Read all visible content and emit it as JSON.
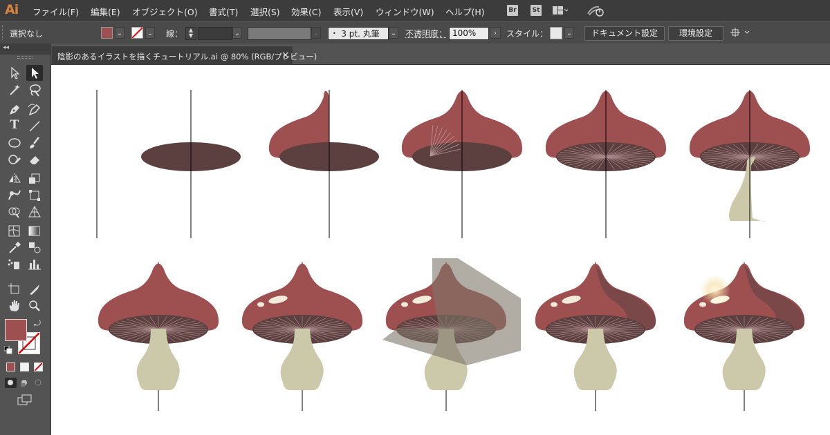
{
  "app": {
    "logo": "Ai"
  },
  "menu": [
    "ファイル(F)",
    "編集(E)",
    "オブジェクト(O)",
    "書式(T)",
    "選択(S)",
    "効果(C)",
    "表示(V)",
    "ウィンドウ(W)",
    "ヘルプ(H)"
  ],
  "app_buttons": {
    "bridge": "Br",
    "stock": "St"
  },
  "control": {
    "selection": "選択なし",
    "stroke_label": "線：",
    "brush": "3 pt. 丸筆",
    "opacity_label": "不透明度：",
    "opacity": "100%",
    "style_label": "スタイル：",
    "doc_settings": "ドキュメント設定",
    "prefs": "環境設定"
  },
  "document_tab": {
    "title": "陰影のあるイラストを描くチュートリアル.ai @ 80% (RGB/プレビュー)",
    "close": "×"
  },
  "colors": {
    "fill": "#9e5050",
    "cap_red": "#9e5050",
    "gill_dark": "#5c3f3f",
    "stem": "#cbc9aa",
    "shadow_band": "#7d7567",
    "highlight": "#f2ebd9"
  },
  "icons": [
    "selection-tool-icon",
    "direct-selection-tool-icon",
    "magic-wand-icon",
    "lasso-icon",
    "pen-tool-icon",
    "curvature-tool-icon",
    "type-tool-icon",
    "line-tool-icon",
    "ellipse-tool-icon",
    "paintbrush-icon",
    "shaper-tool-icon",
    "eraser-icon",
    "reflect-tool-icon",
    "scale-tool-icon",
    "warp-tool-icon",
    "free-transform-icon",
    "shape-builder-icon",
    "perspective-grid-icon",
    "mesh-tool-icon",
    "gradient-tool-icon",
    "eyedropper-icon",
    "blend-tool-icon",
    "symbol-sprayer-icon",
    "column-graph-icon",
    "artboard-tool-icon",
    "slice-tool-icon",
    "hand-tool-icon",
    "zoom-tool-icon"
  ]
}
